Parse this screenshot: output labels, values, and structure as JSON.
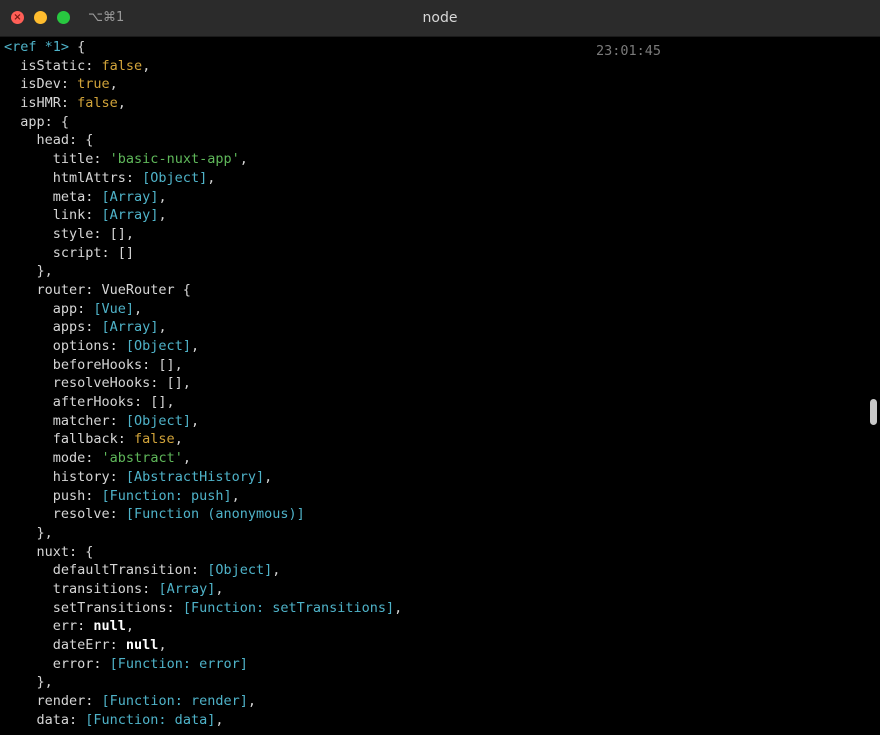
{
  "window": {
    "title": "node",
    "shortcut": "⌥⌘1",
    "timestamp": "23:01:45"
  },
  "terminal": {
    "lines": [
      [
        {
          "t": "<ref *1> ",
          "c": "cy"
        },
        {
          "t": "{",
          "c": "k"
        }
      ],
      [
        {
          "t": "  isStatic: ",
          "c": "k"
        },
        {
          "t": "false",
          "c": "bl"
        },
        {
          "t": ",",
          "c": "k"
        }
      ],
      [
        {
          "t": "  isDev: ",
          "c": "k"
        },
        {
          "t": "true",
          "c": "bl"
        },
        {
          "t": ",",
          "c": "k"
        }
      ],
      [
        {
          "t": "  isHMR: ",
          "c": "k"
        },
        {
          "t": "false",
          "c": "bl"
        },
        {
          "t": ",",
          "c": "k"
        }
      ],
      [
        {
          "t": "  app: {",
          "c": "k"
        }
      ],
      [
        {
          "t": "    head: {",
          "c": "k"
        }
      ],
      [
        {
          "t": "      title: ",
          "c": "k"
        },
        {
          "t": "'basic-nuxt-app'",
          "c": "str"
        },
        {
          "t": ",",
          "c": "k"
        }
      ],
      [
        {
          "t": "      htmlAttrs: ",
          "c": "k"
        },
        {
          "t": "[Object]",
          "c": "cy"
        },
        {
          "t": ",",
          "c": "k"
        }
      ],
      [
        {
          "t": "      meta: ",
          "c": "k"
        },
        {
          "t": "[Array]",
          "c": "cy"
        },
        {
          "t": ",",
          "c": "k"
        }
      ],
      [
        {
          "t": "      link: ",
          "c": "k"
        },
        {
          "t": "[Array]",
          "c": "cy"
        },
        {
          "t": ",",
          "c": "k"
        }
      ],
      [
        {
          "t": "      style: [],",
          "c": "k"
        }
      ],
      [
        {
          "t": "      script: []",
          "c": "k"
        }
      ],
      [
        {
          "t": "    },",
          "c": "k"
        }
      ],
      [
        {
          "t": "    router: VueRouter {",
          "c": "k"
        }
      ],
      [
        {
          "t": "      app: ",
          "c": "k"
        },
        {
          "t": "[Vue]",
          "c": "cy"
        },
        {
          "t": ",",
          "c": "k"
        }
      ],
      [
        {
          "t": "      apps: ",
          "c": "k"
        },
        {
          "t": "[Array]",
          "c": "cy"
        },
        {
          "t": ",",
          "c": "k"
        }
      ],
      [
        {
          "t": "      options: ",
          "c": "k"
        },
        {
          "t": "[Object]",
          "c": "cy"
        },
        {
          "t": ",",
          "c": "k"
        }
      ],
      [
        {
          "t": "      beforeHooks: [],",
          "c": "k"
        }
      ],
      [
        {
          "t": "      resolveHooks: [],",
          "c": "k"
        }
      ],
      [
        {
          "t": "      afterHooks: [],",
          "c": "k"
        }
      ],
      [
        {
          "t": "      matcher: ",
          "c": "k"
        },
        {
          "t": "[Object]",
          "c": "cy"
        },
        {
          "t": ",",
          "c": "k"
        }
      ],
      [
        {
          "t": "      fallback: ",
          "c": "k"
        },
        {
          "t": "false",
          "c": "bl"
        },
        {
          "t": ",",
          "c": "k"
        }
      ],
      [
        {
          "t": "      mode: ",
          "c": "k"
        },
        {
          "t": "'abstract'",
          "c": "str"
        },
        {
          "t": ",",
          "c": "k"
        }
      ],
      [
        {
          "t": "      history: ",
          "c": "k"
        },
        {
          "t": "[AbstractHistory]",
          "c": "cy"
        },
        {
          "t": ",",
          "c": "k"
        }
      ],
      [
        {
          "t": "      push: ",
          "c": "k"
        },
        {
          "t": "[Function: push]",
          "c": "cy"
        },
        {
          "t": ",",
          "c": "k"
        }
      ],
      [
        {
          "t": "      resolve: ",
          "c": "k"
        },
        {
          "t": "[Function (anonymous)]",
          "c": "cy"
        }
      ],
      [
        {
          "t": "    },",
          "c": "k"
        }
      ],
      [
        {
          "t": "    nuxt: {",
          "c": "k"
        }
      ],
      [
        {
          "t": "      defaultTransition: ",
          "c": "k"
        },
        {
          "t": "[Object]",
          "c": "cy"
        },
        {
          "t": ",",
          "c": "k"
        }
      ],
      [
        {
          "t": "      transitions: ",
          "c": "k"
        },
        {
          "t": "[Array]",
          "c": "cy"
        },
        {
          "t": ",",
          "c": "k"
        }
      ],
      [
        {
          "t": "      setTransitions: ",
          "c": "k"
        },
        {
          "t": "[Function: setTransitions]",
          "c": "cy"
        },
        {
          "t": ",",
          "c": "k"
        }
      ],
      [
        {
          "t": "      err: ",
          "c": "k"
        },
        {
          "t": "null",
          "c": "nul"
        },
        {
          "t": ",",
          "c": "k"
        }
      ],
      [
        {
          "t": "      dateErr: ",
          "c": "k"
        },
        {
          "t": "null",
          "c": "nul"
        },
        {
          "t": ",",
          "c": "k"
        }
      ],
      [
        {
          "t": "      error: ",
          "c": "k"
        },
        {
          "t": "[Function: error]",
          "c": "cy"
        }
      ],
      [
        {
          "t": "    },",
          "c": "k"
        }
      ],
      [
        {
          "t": "    render: ",
          "c": "k"
        },
        {
          "t": "[Function: render]",
          "c": "cy"
        },
        {
          "t": ",",
          "c": "k"
        }
      ],
      [
        {
          "t": "    data: ",
          "c": "k"
        },
        {
          "t": "[Function: data]",
          "c": "cy"
        },
        {
          "t": ",",
          "c": "k"
        }
      ]
    ]
  },
  "colors": {
    "background": "#000000",
    "text": "#d6d6d6",
    "cyan_ref": "#4fb3c9",
    "string_green": "#5fb85a",
    "boolean_yellow": "#d2a43a",
    "null_white": "#ffffff",
    "close_button": "#ff5f57",
    "minimize_button": "#febc2e",
    "maximize_button": "#28c840"
  }
}
